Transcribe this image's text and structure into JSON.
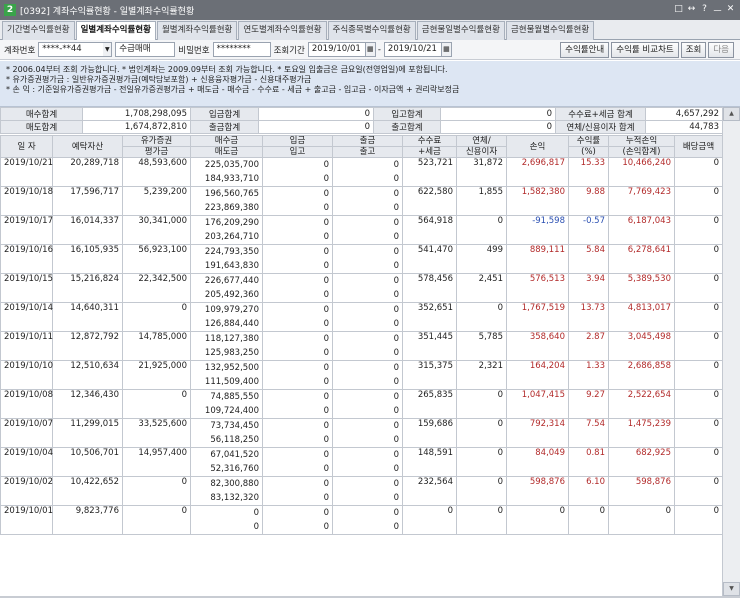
{
  "window": {
    "app_icon": "2",
    "title": "[0392] 계좌수익률현황 - 일별계좌수익률현황",
    "controls": [
      "□",
      "↔",
      "?",
      "ㅡ",
      "✕"
    ]
  },
  "tabs": [
    {
      "label": "기간별수익률현황",
      "active": false
    },
    {
      "label": "일별계좌수익률현황",
      "active": true
    },
    {
      "label": "월별계좌수익률현황",
      "active": false
    },
    {
      "label": "연도별계좌수익률현황",
      "active": false
    },
    {
      "label": "주식종목별수익률현황",
      "active": false
    },
    {
      "label": "금현물일별수익률현황",
      "active": false
    },
    {
      "label": "금현물월별수익률현황",
      "active": false
    }
  ],
  "toolbar": {
    "account_label": "계좌번호",
    "account_value": "****-**44",
    "account_name": "수급매매",
    "password_label": "비밀번호",
    "password_value": "********",
    "period_label": "조회기간",
    "date_from": "2019/10/01",
    "date_sep": "-",
    "date_to": "2019/10/21",
    "btn_guide": "수익률안내",
    "btn_compare": "수익률 비교차트",
    "btn_search": "조회",
    "btn_next": "다음"
  },
  "notes": [
    "* 2006.04부터 조회 가능합니다.  * 법인계좌는 2009.09부터 조회 가능합니다.  * 토요일 입출금은 금요일(전영업일)에 포함됩니다.",
    "* 유가증권평가금 : 일반유가증권평가금(예탁담보포함) + 신용융자평가금 - 신용대주평가금",
    "* 손        익 : 기준일유가증권평가금 - 전일유가증권평가금 + 매도금 - 매수금 - 수수료 - 세금 + 출고금 - 입고금 - 이자금액 + 권리락보정금"
  ],
  "summary": {
    "buy_total_label": "매수합계",
    "buy_total": "1,708,298,095",
    "deposit_total_label": "입금합계",
    "deposit_total": "0",
    "stock_in_total_label": "입고합계",
    "stock_in_total": "0",
    "fee_tax_total_label": "수수료+세금 합계",
    "fee_tax_total": "4,657,292",
    "sell_total_label": "매도합계",
    "sell_total": "1,674,872,810",
    "withdraw_total_label": "출금합계",
    "withdraw_total": "0",
    "stock_out_total_label": "출고합계",
    "stock_out_total": "0",
    "interest_total_label": "연체/신용이자 합계",
    "interest_total": "44,783"
  },
  "grid": {
    "headers": {
      "date": "일 자",
      "deposit_assets": "예탁자산",
      "eval": [
        "유가증권",
        "평가금"
      ],
      "buy_sell": [
        "매수금",
        "매도금"
      ],
      "in": [
        "입금",
        "입고"
      ],
      "out": [
        "출금",
        "출고"
      ],
      "fee": [
        "수수료",
        "+세금"
      ],
      "interest": [
        "연체/",
        "신용이자"
      ],
      "pnl": "손익",
      "rate": [
        "수익률",
        "(%)"
      ],
      "cum": [
        "누적손익",
        "(손익합계)"
      ],
      "dividend": "배당금액"
    },
    "rows": [
      {
        "date": "2019/10/21",
        "assets": "20,289,718",
        "eval": "48,593,600",
        "buy": "225,035,700",
        "sell": "184,933,710",
        "dep": "0",
        "stin": "0",
        "wd": "0",
        "stout": "0",
        "fee": "523,721",
        "int": "31,872",
        "pnl": "2,696,817",
        "pnl_sign": "pos",
        "rate": "15.33",
        "cum": "10,466,240",
        "cum_sign": "pos",
        "div": "0"
      },
      {
        "date": "2019/10/18",
        "assets": "17,596,717",
        "eval": "5,239,200",
        "buy": "196,560,765",
        "sell": "223,869,380",
        "dep": "0",
        "stin": "0",
        "wd": "0",
        "stout": "0",
        "fee": "622,580",
        "int": "1,855",
        "pnl": "1,582,380",
        "pnl_sign": "pos",
        "rate": "9.88",
        "cum": "7,769,423",
        "cum_sign": "pos",
        "div": "0"
      },
      {
        "date": "2019/10/17",
        "assets": "16,014,337",
        "eval": "30,341,000",
        "buy": "176,209,290",
        "sell": "203,264,710",
        "dep": "0",
        "stin": "0",
        "wd": "0",
        "stout": "0",
        "fee": "564,918",
        "int": "0",
        "pnl": "-91,598",
        "pnl_sign": "neg",
        "rate": "-0.57",
        "cum": "6,187,043",
        "cum_sign": "pos",
        "div": "0"
      },
      {
        "date": "2019/10/16",
        "assets": "16,105,935",
        "eval": "56,923,100",
        "buy": "224,793,350",
        "sell": "191,643,830",
        "dep": "0",
        "stin": "0",
        "wd": "0",
        "stout": "0",
        "fee": "541,470",
        "int": "499",
        "pnl": "889,111",
        "pnl_sign": "pos",
        "rate": "5.84",
        "cum": "6,278,641",
        "cum_sign": "pos",
        "div": "0"
      },
      {
        "date": "2019/10/15",
        "assets": "15,216,824",
        "eval": "22,342,500",
        "buy": "226,677,440",
        "sell": "205,492,360",
        "dep": "0",
        "stin": "0",
        "wd": "0",
        "stout": "0",
        "fee": "578,456",
        "int": "2,451",
        "pnl": "576,513",
        "pnl_sign": "pos",
        "rate": "3.94",
        "cum": "5,389,530",
        "cum_sign": "pos",
        "div": "0"
      },
      {
        "date": "2019/10/14",
        "assets": "14,640,311",
        "eval": "0",
        "buy": "109,979,270",
        "sell": "126,884,440",
        "dep": "0",
        "stin": "0",
        "wd": "0",
        "stout": "0",
        "fee": "352,651",
        "int": "0",
        "pnl": "1,767,519",
        "pnl_sign": "pos",
        "rate": "13.73",
        "cum": "4,813,017",
        "cum_sign": "pos",
        "div": "0"
      },
      {
        "date": "2019/10/11",
        "assets": "12,872,792",
        "eval": "14,785,000",
        "buy": "118,127,380",
        "sell": "125,983,250",
        "dep": "0",
        "stin": "0",
        "wd": "0",
        "stout": "0",
        "fee": "351,445",
        "int": "5,785",
        "pnl": "358,640",
        "pnl_sign": "pos",
        "rate": "2.87",
        "cum": "3,045,498",
        "cum_sign": "pos",
        "div": "0"
      },
      {
        "date": "2019/10/10",
        "assets": "12,510,634",
        "eval": "21,925,000",
        "buy": "132,952,500",
        "sell": "111,509,400",
        "dep": "0",
        "stin": "0",
        "wd": "0",
        "stout": "0",
        "fee": "315,375",
        "int": "2,321",
        "pnl": "164,204",
        "pnl_sign": "pos",
        "rate": "1.33",
        "cum": "2,686,858",
        "cum_sign": "pos",
        "div": "0"
      },
      {
        "date": "2019/10/08",
        "assets": "12,346,430",
        "eval": "0",
        "buy": "74,885,550",
        "sell": "109,724,400",
        "dep": "0",
        "stin": "0",
        "wd": "0",
        "stout": "0",
        "fee": "265,835",
        "int": "0",
        "pnl": "1,047,415",
        "pnl_sign": "pos",
        "rate": "9.27",
        "cum": "2,522,654",
        "cum_sign": "pos",
        "div": "0"
      },
      {
        "date": "2019/10/07",
        "assets": "11,299,015",
        "eval": "33,525,600",
        "buy": "73,734,450",
        "sell": "56,118,250",
        "dep": "0",
        "stin": "0",
        "wd": "0",
        "stout": "0",
        "fee": "159,686",
        "int": "0",
        "pnl": "792,314",
        "pnl_sign": "pos",
        "rate": "7.54",
        "cum": "1,475,239",
        "cum_sign": "pos",
        "div": "0"
      },
      {
        "date": "2019/10/04",
        "assets": "10,506,701",
        "eval": "14,957,400",
        "buy": "67,041,520",
        "sell": "52,316,760",
        "dep": "0",
        "stin": "0",
        "wd": "0",
        "stout": "0",
        "fee": "148,591",
        "int": "0",
        "pnl": "84,049",
        "pnl_sign": "pos",
        "rate": "0.81",
        "cum": "682,925",
        "cum_sign": "pos",
        "div": "0"
      },
      {
        "date": "2019/10/02",
        "assets": "10,422,652",
        "eval": "0",
        "buy": "82,300,880",
        "sell": "83,132,320",
        "dep": "0",
        "stin": "0",
        "wd": "0",
        "stout": "0",
        "fee": "232,564",
        "int": "0",
        "pnl": "598,876",
        "pnl_sign": "pos",
        "rate": "6.10",
        "cum": "598,876",
        "cum_sign": "pos",
        "div": "0"
      },
      {
        "date": "2019/10/01",
        "assets": "9,823,776",
        "eval": "0",
        "buy": "0",
        "sell": "0",
        "dep": "0",
        "stin": "0",
        "wd": "0",
        "stout": "0",
        "fee": "0",
        "int": "0",
        "pnl": "0",
        "pnl_sign": "",
        "rate": "0",
        "cum": "0",
        "cum_sign": "",
        "div": "0"
      }
    ]
  },
  "scrollbar": {
    "up": "▲",
    "down": "▼"
  }
}
